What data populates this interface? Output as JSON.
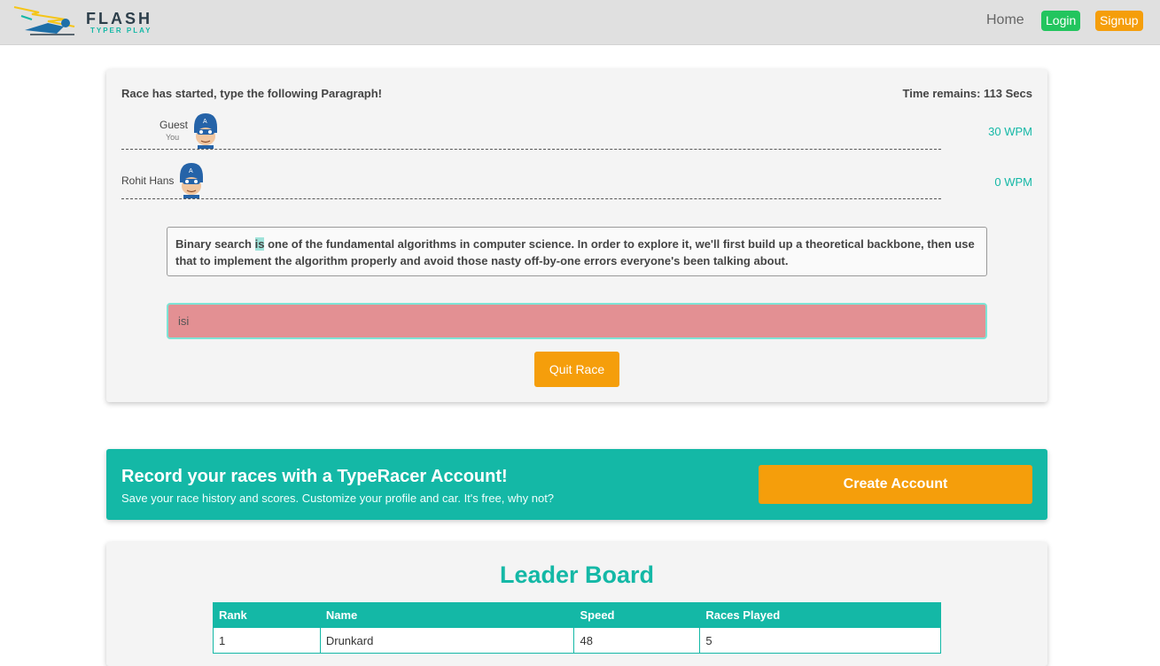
{
  "navbar": {
    "logo_title": "FLASH",
    "logo_subtitle": "TYPER PLAY",
    "home": "Home",
    "login": "Login",
    "signup": "Signup"
  },
  "race": {
    "status": "Race has started, type the following Paragraph!",
    "time_remains": "Time remains: 113 Secs",
    "players": [
      {
        "name": "Guest",
        "sub": "You",
        "wpm": "30 WPM"
      },
      {
        "name": "Rohit Hans",
        "sub": "",
        "wpm": "0 WPM"
      }
    ],
    "paragraph_before": "Binary search ",
    "paragraph_current": "is",
    "paragraph_after": " one of the fundamental algorithms in computer science. In order to explore it, we'll first build up a theoretical backbone, then use that to implement the algorithm properly and avoid those nasty off-by-one errors everyone's been talking about.",
    "input_value": "isi",
    "quit_label": "Quit Race"
  },
  "banner": {
    "title": "Record your races with a TypeRacer Account!",
    "subtitle": "Save your race history and scores. Customize your profile and car. It's free, why not?",
    "button": "Create Account"
  },
  "leaderboard": {
    "title": "Leader Board",
    "columns": [
      "Rank",
      "Name",
      "Speed",
      "Races Played"
    ],
    "rows": [
      [
        "1",
        "Drunkard",
        "48",
        "5"
      ]
    ]
  },
  "colors": {
    "accent": "#14b8a6",
    "orange": "#f59e0b",
    "green": "#22c55e",
    "input_error": "#e39093"
  }
}
